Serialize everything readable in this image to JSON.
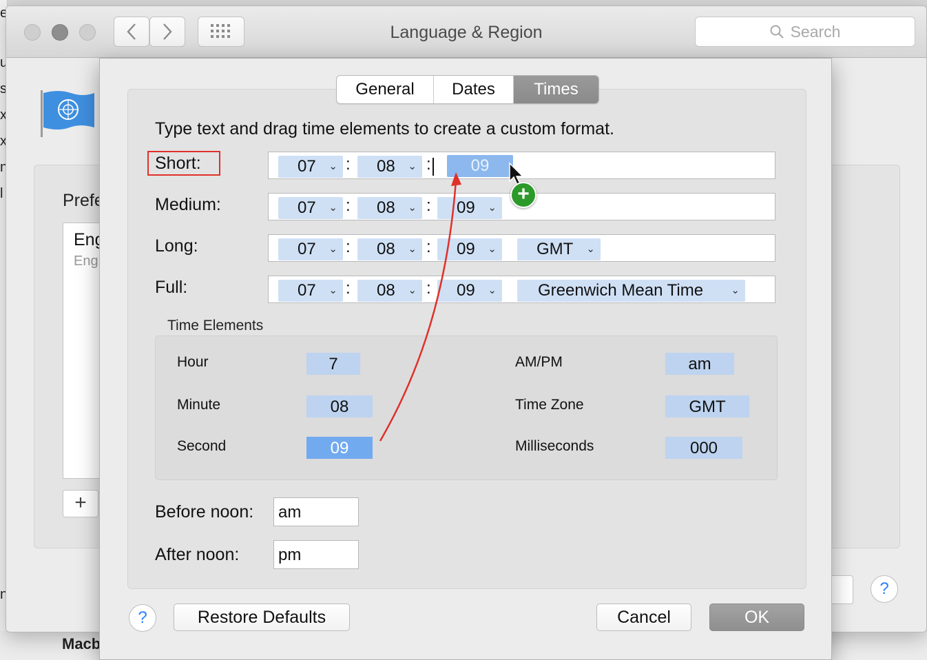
{
  "window": {
    "title": "Language & Region",
    "search_placeholder": "Search"
  },
  "background": {
    "left_letters": [
      "e",
      "u",
      "s",
      "x",
      "x",
      "n",
      "l",
      "n"
    ],
    "bottom_text": "Macb"
  },
  "main": {
    "preferred_label": "Prefe",
    "language_item": "Eng",
    "language_sub": "Eng",
    "add_label": "+",
    "help_label": "?"
  },
  "tabs": [
    {
      "label": "General",
      "active": false
    },
    {
      "label": "Dates",
      "active": false
    },
    {
      "label": "Times",
      "active": true
    }
  ],
  "instruction": "Type text and drag time elements to create a custom format.",
  "formats": {
    "short": {
      "label": "Short:",
      "hour": "07",
      "minute": "08",
      "sep": ":",
      "dragging": "09"
    },
    "medium": {
      "label": "Medium:",
      "hour": "07",
      "minute": "08",
      "second": "09",
      "sep": ":"
    },
    "long": {
      "label": "Long:",
      "hour": "07",
      "minute": "08",
      "second": "09",
      "zone": "GMT",
      "sep": ":"
    },
    "full": {
      "label": "Full:",
      "hour": "07",
      "minute": "08",
      "second": "09",
      "zone": "Greenwich Mean Time",
      "sep": ":"
    }
  },
  "time_elements": {
    "title": "Time Elements",
    "hour": {
      "label": "Hour",
      "value": "7"
    },
    "minute": {
      "label": "Minute",
      "value": "08"
    },
    "second": {
      "label": "Second",
      "value": "09"
    },
    "ampm": {
      "label": "AM/PM",
      "value": "am"
    },
    "timezone": {
      "label": "Time Zone",
      "value": "GMT"
    },
    "milliseconds": {
      "label": "Milliseconds",
      "value": "000"
    }
  },
  "noon": {
    "before_label": "Before noon:",
    "before_value": "am",
    "after_label": "After noon:",
    "after_value": "pm"
  },
  "buttons": {
    "help": "?",
    "restore": "Restore Defaults",
    "cancel": "Cancel",
    "ok": "OK"
  },
  "colors": {
    "token": "#cfe0f5",
    "token_dragging": "#8cb8ee",
    "selected_element": "#72aaf0",
    "annotation": "#e0302a",
    "add_badge": "#2c9a2a"
  }
}
